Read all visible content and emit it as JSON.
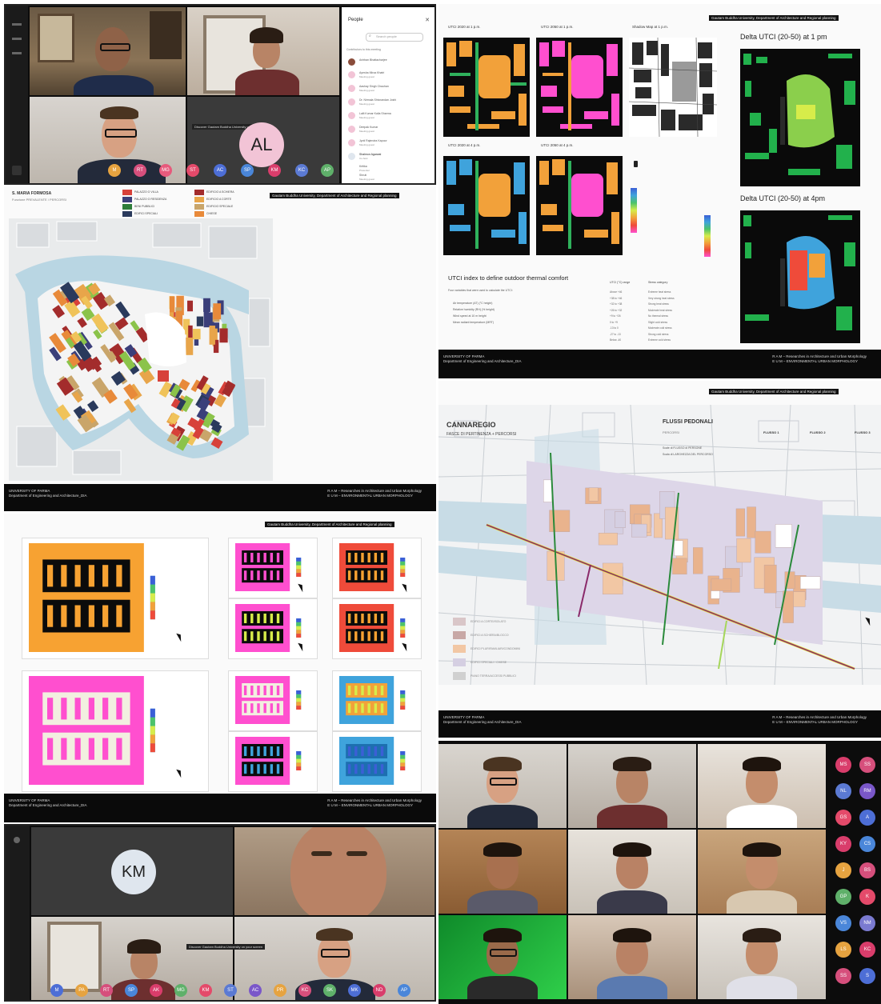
{
  "meet1": {
    "people_title": "People",
    "search_placeholder": "Search people",
    "in_call_label": "Contributors to this meeting",
    "participants": [
      {
        "name": "Anirban Bhattacharjee",
        "sub": ""
      },
      {
        "name": "Ayesha Mirza Khatri",
        "sub": "Meeting guest"
      },
      {
        "name": "Aashay Singh Chauhan",
        "sub": "Meeting guest"
      },
      {
        "name": "Dr. Nirmala Shivnandan Joshi",
        "sub": "Meeting guest"
      },
      {
        "name": "Lalit Kumar Kalia Sharma",
        "sub": "Meeting guest"
      },
      {
        "name": "Deepak Kumar",
        "sub": "Meeting guest"
      },
      {
        "name": "Jyoti Rajendra Kapoor",
        "sub": "Meeting guest"
      },
      {
        "name": "Shalmon Agarwal",
        "sub": "Co-host"
      },
      {
        "name": "Kritika",
        "sub": "Presenter"
      },
      {
        "name": "Shruti",
        "sub": "Meeting guest"
      }
    ],
    "avatar_initials": "AL",
    "tooltip": "Discover Gautam Buddha University on your screen",
    "toolbar": [
      "M",
      "RT",
      "MG",
      "ST",
      "AC",
      "SP",
      "KM",
      "KC",
      "AP"
    ]
  },
  "slide_utci": {
    "header": "Gautam Buddha University, Department of Architecture and Regional planning",
    "thumb_titles": [
      "UTCI 2020 at 1 p.m.",
      "UTCI 2050 at 1 p.m.",
      "Shadow Map at 1 p.m.",
      "UTCI 2020 at 4 p.m.",
      "UTCI 2050 at 4 p.m."
    ],
    "delta_1pm": "Delta UTCI (20-50) at 1 pm",
    "delta_4pm": "Delta UTCI (20-50) at 4pm",
    "section_title": "UTCI index to define outdoor thermal comfort",
    "section_desc": "Four variables that were used to calculate the UTCI:",
    "variables": [
      "Air temperature (AT) (°C height)",
      "Relative humidity (RH) (% height)",
      "Wind speed at 10 m height",
      "Mean radiant temperature (MRT)"
    ],
    "table_headers": [
      "UTCI (°C) range",
      "Stress category"
    ],
    "table_rows": [
      [
        "Above +46",
        "Extreme heat stress"
      ],
      [
        "+38 to +46",
        "Very strong heat stress"
      ],
      [
        "+32 to +38",
        "Strong heat stress"
      ],
      [
        "+26 to +32",
        "Moderate heat stress"
      ],
      [
        "+9 to +26",
        "No thermal stress"
      ],
      [
        "0 to +9",
        "Slight cold stress"
      ],
      [
        "-13 to 0",
        "Moderate cold stress"
      ],
      [
        "-27 to -13",
        "Strong cold stress"
      ],
      [
        "Below -40",
        "Extreme cold stress"
      ]
    ],
    "footer_left": [
      "UNIVERSITY OF PARMA",
      "Department of Engineering and Architecture_DIA"
    ],
    "footer_right": [
      "R A M – Researches in Architecture and Urban Morphology",
      "E U M – ENVIRONMENTAL URBAN MORPHOLOGY"
    ]
  },
  "slide_map1": {
    "title": "S. MARIA FORMOSA",
    "subtitle": "Funzione PREVALENTE / PERCORSI",
    "header": "Gautam Buddha University, Department of Architecture and Regional planning",
    "legend": [
      {
        "label": "PALAZZO O VILLA",
        "color": "#d7413a"
      },
      {
        "label": "PALAZZO O RESIDENZA",
        "color": "#3b3f7a"
      },
      {
        "label": "BENI PUBBLICI",
        "color": "#2e7d3a"
      },
      {
        "label": "EDIFICI SPECIALI",
        "color": "#2a3a5c"
      },
      {
        "label": "EDIFICI RESIDENZIALI",
        "color": "#8bc34a"
      },
      {
        "label": "SPAZIO PUBBLICO",
        "color": "#a9c7d8"
      },
      {
        "label": "EDIFICIO A SCHIERA",
        "color": "#a32c2c"
      },
      {
        "label": "EDIFICIO A CORTE",
        "color": "#e8a54a"
      },
      {
        "label": "EDIFICIO SPECIALE",
        "color": "#c9a56a"
      },
      {
        "label": "CHIESE",
        "color": "#e88a3a"
      },
      {
        "label": "CORTILE",
        "color": "#d0d0d0"
      },
      {
        "label": "VERDE",
        "color": "#6fa04a"
      }
    ],
    "footer_left": [
      "UNIVERSITY OF PARMA",
      "Department of Engineering and Architecture_DIA"
    ],
    "footer_right": [
      "R A M – Researches in Architecture and Urban Morphology",
      "E U M – ENVIRONMENTAL URBAN MORPHOLOGY"
    ]
  },
  "slide_cannaregio": {
    "header": "Gautam Buddha University, Department of Architecture and Regional planning",
    "title": "CANNAREGIO",
    "subtitle": "FASCE DI PERTINENZA + PERCORSI",
    "flussi_title": "FLUSSI PEDONALI",
    "flussi_sub": "PERCORSI",
    "flussi_lines": [
      "Scale di FLUSSO di PERSONE",
      "Scala di LARGHEZZA DEL PERCORSO"
    ],
    "flussi_cols": [
      "FLUSSO 1",
      "FLUSSO 2",
      "FLUSSO 3"
    ],
    "legend": [
      "EDIFICI A CORTE/ISOLATO",
      "EDIFICI A SCHIERA/BLOCCO",
      "EDIFICI PLURIFAMILIARI/CONDOMINI",
      "EDIFICI SPECIALI / CHIESE",
      "PIANO TERRA/ACCESSI PUBBLICI"
    ],
    "footer_left": [
      "UNIVERSITY OF PARMA",
      "Department of Engineering and Architecture_DIA"
    ],
    "footer_right": [
      "R A M – Researches in Architecture and Urban Morphology",
      "E U M – ENVIRONMENTAL URBAN MORPHOLOGY"
    ]
  },
  "slide_heat": {
    "header": "Gautam Buddha University, Department of Architecture and Regional planning",
    "footer_left": [
      "UNIVERSITY OF PARMA",
      "Department of Engineering and Architecture_DIA"
    ],
    "footer_right": [
      "R A M – Researches in Architecture and Urban Morphology",
      "E U M – ENVIRONMENTAL URBAN MORPHOLOGY"
    ]
  },
  "meet2": {
    "avatar_initials": "KM",
    "tooltip": "Discover Gautam Buddha University on your screen",
    "toolbar": [
      "M",
      "PA",
      "RT",
      "SP",
      "AK",
      "MG",
      "KM",
      "ST",
      "AC",
      "PR",
      "KC",
      "SK",
      "MK",
      "ND",
      "AP"
    ]
  },
  "meet3": {
    "side_avatars": [
      "MS",
      "SS",
      "NL",
      "RM",
      "GS",
      "A",
      "KY",
      "CS",
      "J",
      "BS",
      "GP",
      "K",
      "VS",
      "NM",
      "LS",
      "KC",
      "SS",
      "S"
    ]
  },
  "colors": {
    "utci_orange": "#f7a232",
    "utci_pink": "#ff4fcf",
    "utci_green": "#8bc34a",
    "utci_blue": "#3fa3dc",
    "water": "#b9d6e3",
    "avatar_pink": "#f2c4d6",
    "avatar_blue": "#dfe6ee"
  }
}
